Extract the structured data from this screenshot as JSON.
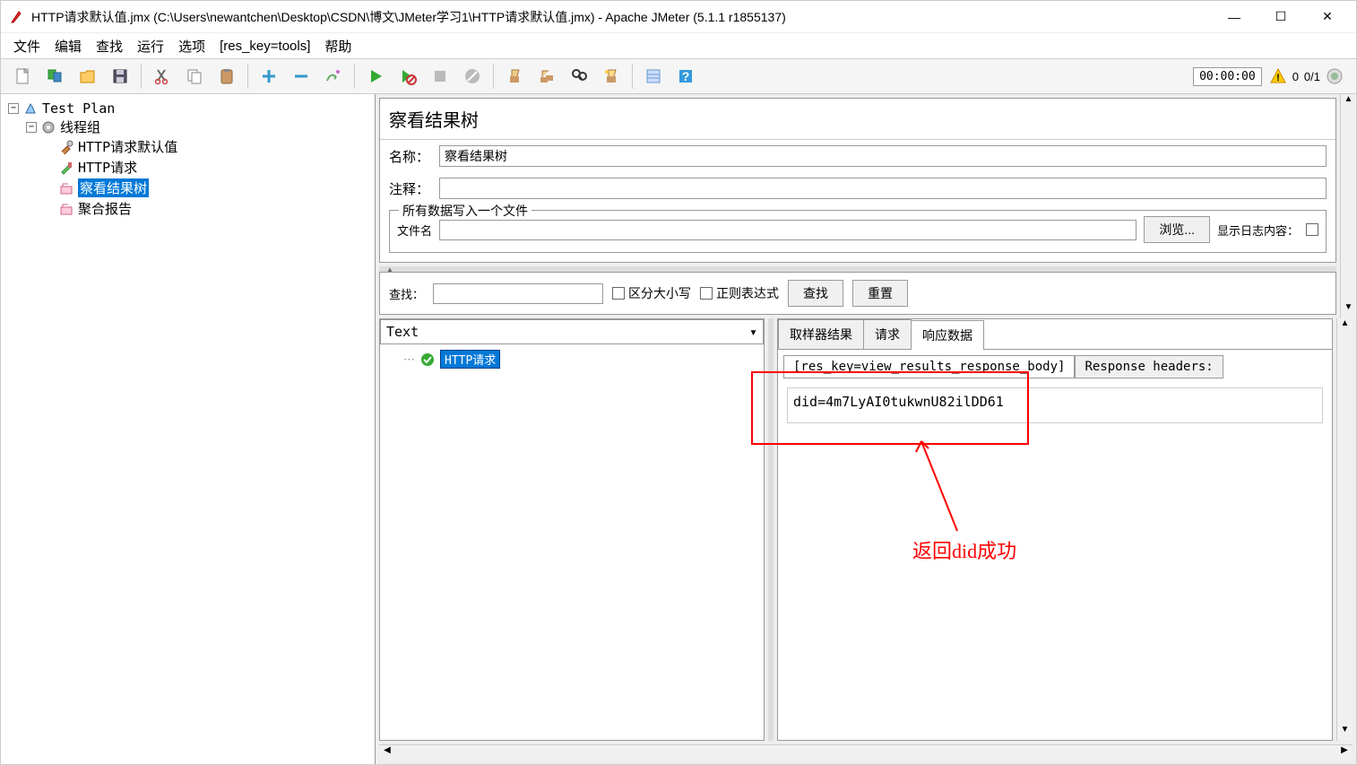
{
  "window": {
    "title": "HTTP请求默认值.jmx (C:\\Users\\newantchen\\Desktop\\CSDN\\博文\\JMeter学习1\\HTTP请求默认值.jmx) - Apache JMeter (5.1.1 r1855137)"
  },
  "menu": {
    "file": "文件",
    "edit": "编辑",
    "search": "查找",
    "run": "运行",
    "options": "选项",
    "tools": "[res_key=tools]",
    "help": "帮助"
  },
  "toolbar": {
    "timer": "00:00:00",
    "warn_count": "0",
    "thread_status": "0/1"
  },
  "tree": {
    "root": "Test Plan",
    "group": "线程组",
    "items": [
      "HTTP请求默认值",
      "HTTP请求",
      "察看结果树",
      "聚合报告"
    ],
    "selected_index": 2
  },
  "panel": {
    "title": "察看结果树",
    "name_label": "名称：",
    "name_value": "察看结果树",
    "comment_label": "注释：",
    "comment_value": "",
    "fileset_legend": "所有数据写入一个文件",
    "filename_label": "文件名",
    "filename_value": "",
    "browse_btn": "浏览...",
    "showlog_label": "显示日志内容："
  },
  "searchbar": {
    "label": "查找：",
    "value": "",
    "case_label": "区分大小写",
    "regex_label": "正则表达式",
    "search_btn": "查找",
    "reset_btn": "重置"
  },
  "results": {
    "renderer": "Text",
    "sample": "HTTP请求",
    "tabs": {
      "sampler": "取样器结果",
      "request": "请求",
      "response": "响应数据"
    },
    "subtabs": {
      "body": "[res_key=view_results_response_body]",
      "headers": "Response headers:"
    },
    "body_text": "did=4m7LyAI0tukwnU82ilDD61"
  },
  "annotation": {
    "text": "返回did成功"
  }
}
